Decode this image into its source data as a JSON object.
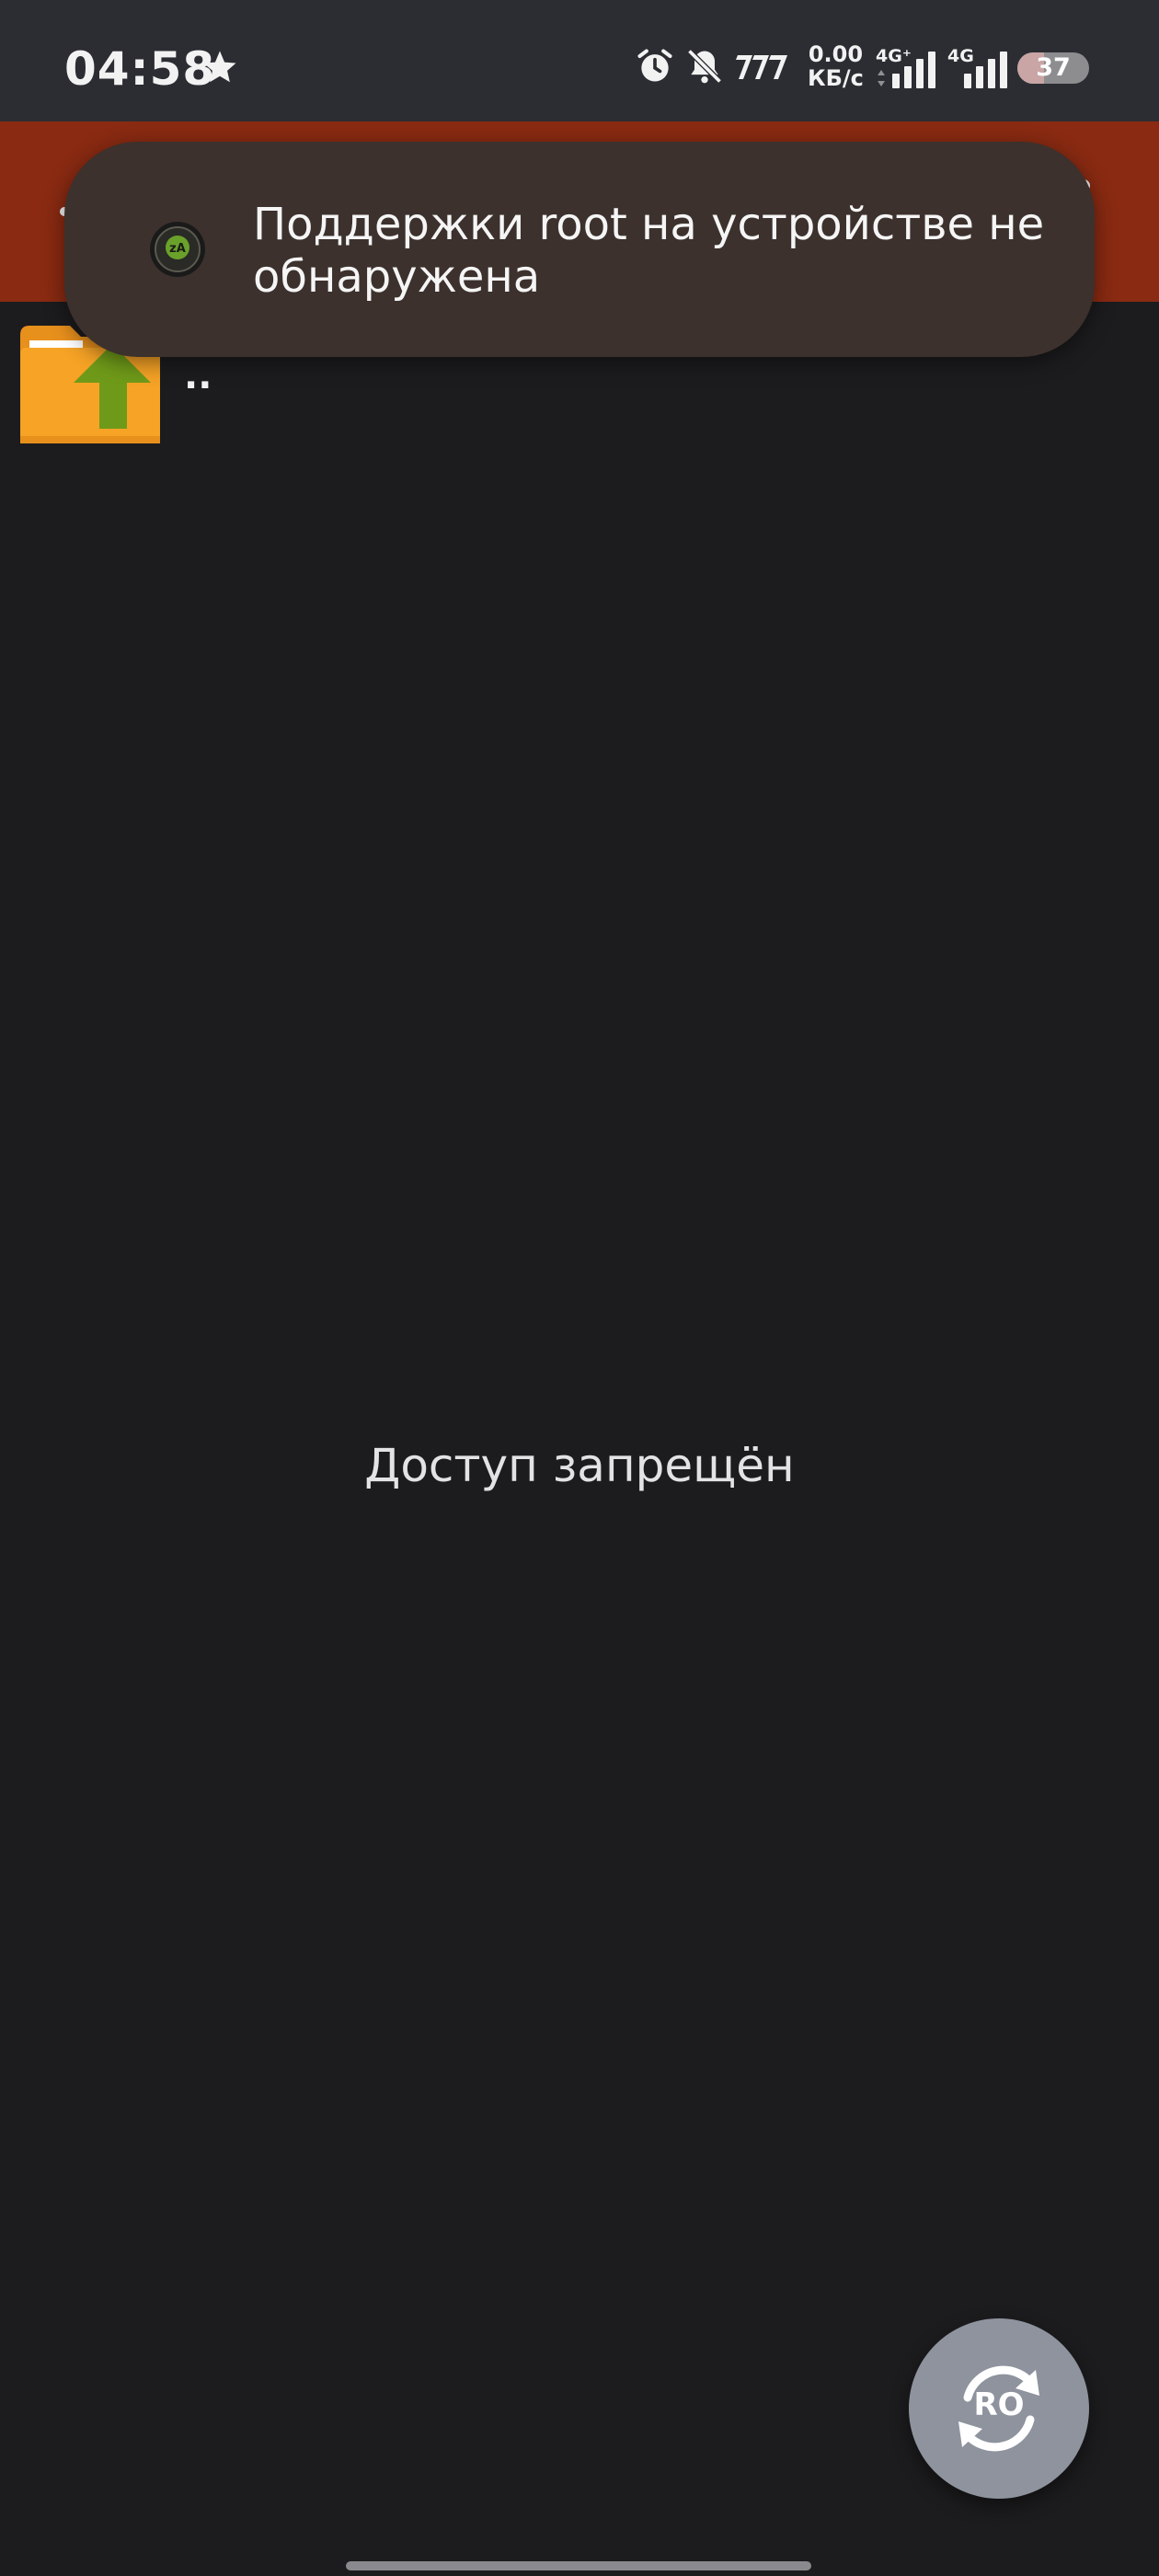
{
  "status_bar": {
    "time": "04:58",
    "net_speed_value": "0.00",
    "net_speed_unit": "КБ/с",
    "sim1_type": "4G⁺",
    "sim2_type": "4G",
    "battery_level": "37",
    "battery_fraction": 0.37,
    "icons": [
      "star-icon",
      "alarm-icon",
      "bell-off-icon",
      "carrier-777-icon",
      "signal-icon",
      "signal-icon"
    ]
  },
  "toolbar": {
    "color": "#8a2a12",
    "menu_icon": "more-vert-icon"
  },
  "file_list": {
    "items": [
      {
        "label": "..",
        "icon": "folder-up-icon"
      }
    ]
  },
  "toast": {
    "message": "Поддержки root на устройстве не обнаружена",
    "icon": "app-icon"
  },
  "empty_state": {
    "message": "Доступ запрещён"
  },
  "fab": {
    "label": "RO",
    "icon": "refresh-icon"
  },
  "colors": {
    "background": "#1c1c1e",
    "toast": "#3c312d",
    "fab": "#8e939e",
    "folder": "#f6a326",
    "arrow": "#6f9a19"
  }
}
